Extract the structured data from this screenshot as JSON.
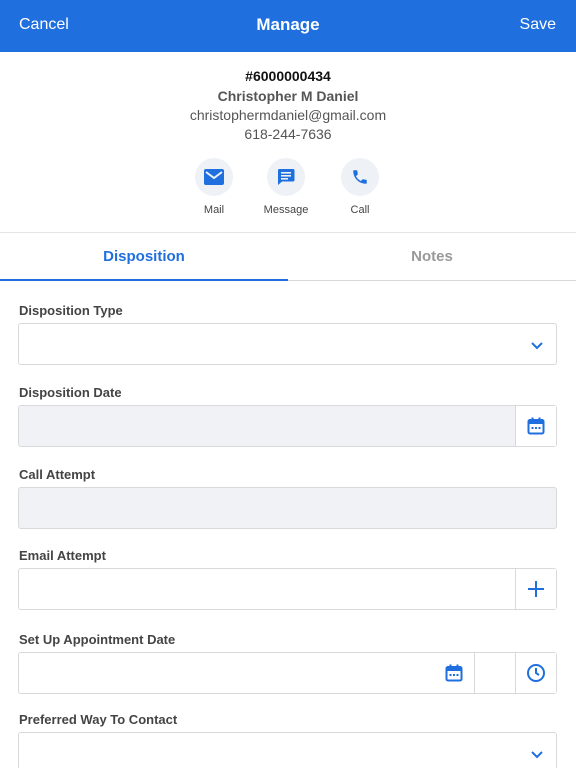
{
  "header": {
    "cancel_label": "Cancel",
    "title": "Manage",
    "save_label": "Save"
  },
  "contact": {
    "lead_id": "#6000000434",
    "name": "Christopher M Daniel",
    "email": "christophermdaniel@gmail.com",
    "phone": "618-244-7636"
  },
  "actions": [
    {
      "label": "Mail",
      "icon": "mail-icon"
    },
    {
      "label": "Message",
      "icon": "message-icon"
    },
    {
      "label": "Call",
      "icon": "phone-icon"
    }
  ],
  "tabs": [
    {
      "label": "Disposition",
      "active": true
    },
    {
      "label": "Notes",
      "active": false
    }
  ],
  "form": {
    "disposition_type": {
      "label": "Disposition Type",
      "value": ""
    },
    "disposition_date": {
      "label": "Disposition Date",
      "value": ""
    },
    "call_attempt": {
      "label": "Call Attempt",
      "value": ""
    },
    "email_attempt": {
      "label": "Email Attempt",
      "value": ""
    },
    "appointment_date": {
      "label": "Set Up Appointment Date",
      "value": ""
    },
    "preferred_contact": {
      "label": "Preferred Way To Contact",
      "value": ""
    }
  },
  "colors": {
    "accent": "#1f6fde",
    "field_disabled_bg": "#f1f2f5",
    "border": "#d9d9d9"
  }
}
